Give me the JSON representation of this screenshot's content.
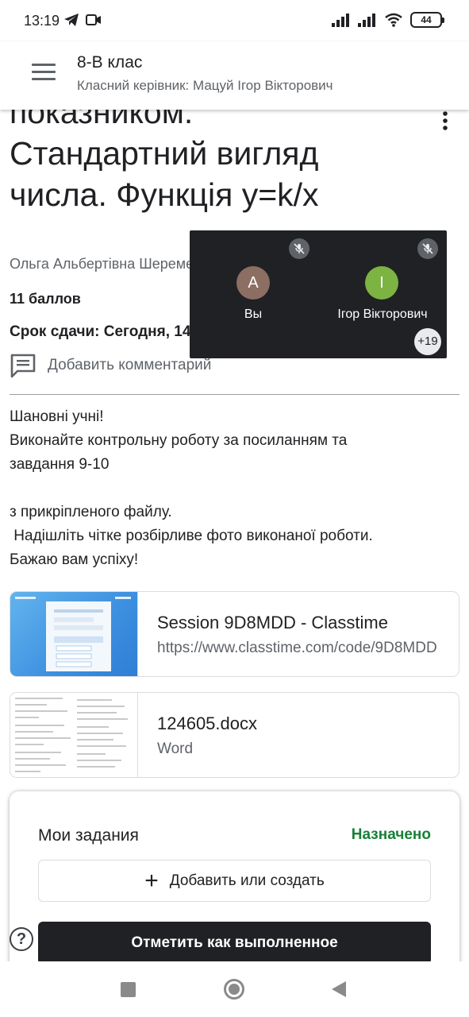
{
  "status_bar": {
    "time": "13:19",
    "battery": "44",
    "icons": [
      "telegram-icon",
      "video-call-icon",
      "signal-icon",
      "signal-icon-2",
      "wifi-icon",
      "battery-icon"
    ]
  },
  "app_bar": {
    "class_name": "8-В клас",
    "teacher": "Класний керівник: Мацуй Ігор Вікторович",
    "menu_icon": "hamburger-menu-icon"
  },
  "assignment": {
    "title_lines": [
      "показником.",
      "Стандартний вигляд",
      "числа. Функція y=k/x"
    ],
    "author": "Ольга Альбертівна Шеремет",
    "points": "11 баллов",
    "due": "Срок сдачи: Сегодня, 14:00",
    "add_comment": "Добавить комментарий",
    "description_lines": [
      "Шановні учні!",
      "Виконайте контрольну роботу за посиланням та",
      "завдання 9-10",
      "",
      "з прикріпленого файлу.",
      " Надішліть чітке розбірливе фото виконаної роботи.",
      "Бажаю вам успіху!"
    ]
  },
  "attachments": [
    {
      "title": "Session 9D8MDD - Classtime",
      "subtitle": "https://www.classtime.com/code/9D8MDD"
    },
    {
      "title": "124605.docx",
      "subtitle": "Word"
    }
  ],
  "my_work": {
    "title": "Мои задания",
    "status": "Назначено",
    "status_color": "#188038",
    "add_label": "Добавить или создать",
    "mark_done_label": "Отметить как выполненное"
  },
  "meet_overlay": {
    "participants": [
      {
        "initial": "A",
        "name": "Вы",
        "color": "#8d6e63"
      },
      {
        "initial": "I",
        "name": "Ігор Вікторович",
        "color": "#7cb342"
      }
    ],
    "more_count": "+19"
  },
  "help": {
    "label": "?"
  }
}
